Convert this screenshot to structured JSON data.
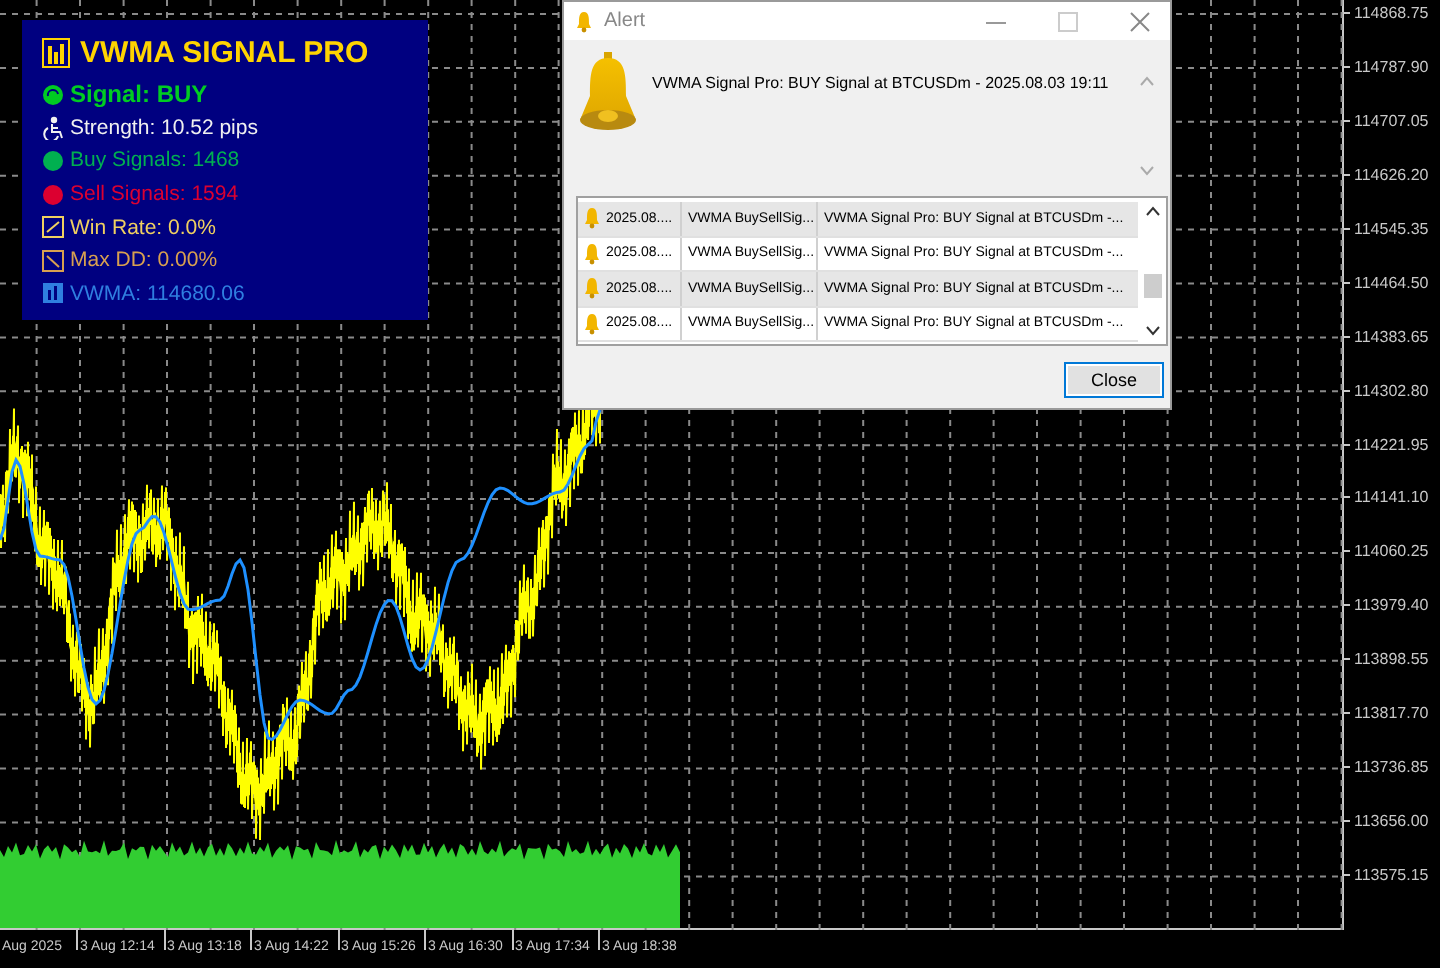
{
  "indicator_panel": {
    "title": "VWMA SIGNAL PRO",
    "lines": [
      {
        "kind": "signal",
        "text": "Signal: BUY",
        "color": "#00cc22"
      },
      {
        "kind": "strength",
        "text": "Strength: 10.52 pips",
        "color": "#f0f0f0"
      },
      {
        "kind": "buy",
        "text": "Buy Signals: 1468",
        "color": "#00b050"
      },
      {
        "kind": "sell",
        "text": "Sell Signals: 1594",
        "color": "#dc0030"
      },
      {
        "kind": "win_rate",
        "text": "Win Rate: 0.0%",
        "color": "#f0d060"
      },
      {
        "kind": "max_dd",
        "text": "Max DD: 0.00%",
        "color": "#d8a050"
      },
      {
        "kind": "vwma",
        "text": "VWMA: 114680.06",
        "color": "#2f7fe0"
      }
    ]
  },
  "alert_dialog": {
    "title": "Alert",
    "message": "VWMA Signal Pro: BUY Signal at BTCUSDm - 2025.08.03 19:11",
    "log": [
      {
        "time": "2025.08....",
        "source": "VWMA BuySellSig...",
        "message": "VWMA Signal Pro: BUY Signal at BTCUSDm -..."
      },
      {
        "time": "2025.08....",
        "source": "VWMA BuySellSig...",
        "message": "VWMA Signal Pro: BUY Signal at BTCUSDm -..."
      },
      {
        "time": "2025.08....",
        "source": "VWMA BuySellSig...",
        "message": "VWMA Signal Pro: BUY Signal at BTCUSDm -..."
      },
      {
        "time": "2025.08....",
        "source": "VWMA BuySellSig...",
        "message": "VWMA Signal Pro: BUY Signal at BTCUSDm -..."
      }
    ],
    "close_button": "Close"
  },
  "price_axis": [
    "114868.75",
    "114787.90",
    "114707.05",
    "114626.20",
    "114545.35",
    "114464.50",
    "114383.65",
    "114302.80",
    "114221.95",
    "114141.10",
    "114060.25",
    "113979.40",
    "113898.55",
    "113817.70",
    "113736.85",
    "113656.00",
    "113575.15"
  ],
  "time_axis": [
    "Aug 2025",
    "3 Aug 12:14",
    "3 Aug 13:18",
    "3 Aug 14:22",
    "3 Aug 15:26",
    "3 Aug 16:30",
    "3 Aug 17:34",
    "3 Aug 18:38"
  ]
}
